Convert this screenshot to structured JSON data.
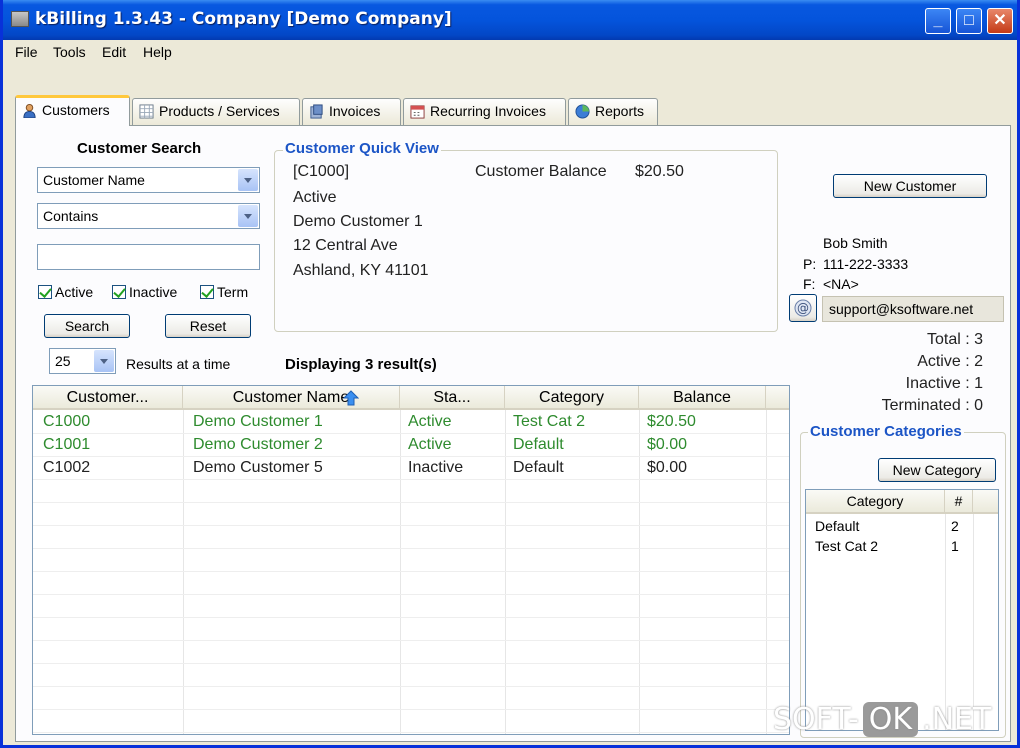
{
  "window": {
    "title": "kBilling 1.3.43 - Company [Demo Company]"
  },
  "menu": [
    "File",
    "Tools",
    "Edit",
    "Help"
  ],
  "tabs": [
    {
      "label": "Customers",
      "active": true,
      "icon": "person-icon"
    },
    {
      "label": "Products / Services",
      "icon": "table-icon"
    },
    {
      "label": "Invoices",
      "icon": "invoice-icon"
    },
    {
      "label": "Recurring Invoices",
      "icon": "calendar-icon"
    },
    {
      "label": "Reports",
      "icon": "chart-icon"
    }
  ],
  "search": {
    "title": "Customer Search",
    "field_select": "Customer Name",
    "operator_select": "Contains",
    "query": "",
    "checkboxes": [
      {
        "label": "Active",
        "checked": true
      },
      {
        "label": "Inactive",
        "checked": true
      },
      {
        "label": "Term",
        "checked": true
      }
    ],
    "search_button": "Search",
    "reset_button": "Reset",
    "results_per_page": "25",
    "results_label": "Results at a time"
  },
  "quick_view": {
    "title": "Customer Quick View",
    "id": "[C1000]",
    "status": "Active",
    "name": "Demo Customer 1",
    "address1": "12 Central Ave",
    "address2": "Ashland, KY 41101",
    "balance_label": "Customer Balance",
    "balance_value": "$20.50"
  },
  "results": {
    "display_text": "Displaying 3 result(s)",
    "columns": [
      "Customer...",
      "Customer Name",
      "Sta...",
      "Category",
      "Balance"
    ],
    "rows": [
      {
        "id": "C1000",
        "name": "Demo Customer 1",
        "status": "Active",
        "category": "Test Cat 2",
        "balance": "$20.50",
        "color": "#2e8b2e"
      },
      {
        "id": "C1001",
        "name": "Demo Customer 2",
        "status": "Active",
        "category": "Default",
        "balance": "$0.00",
        "color": "#2e8b2e"
      },
      {
        "id": "C1002",
        "name": "Demo Customer 5",
        "status": "Inactive",
        "category": "Default",
        "balance": "$0.00",
        "color": "#222222"
      }
    ]
  },
  "contact": {
    "new_customer_button": "New Customer",
    "name": "Bob Smith",
    "phone_label": "P:",
    "phone": "111-222-3333",
    "fax_label": "F:",
    "fax": "<NA>",
    "email": "support@ksoftware.net"
  },
  "counts": {
    "total": "Total : 3",
    "active": "Active : 2",
    "inactive": "Inactive : 1",
    "terminated": "Terminated : 0"
  },
  "categories": {
    "title": "Customer Categories",
    "new_button": "New Category",
    "columns": [
      "Category",
      "#"
    ],
    "rows": [
      {
        "name": "Default",
        "count": "2"
      },
      {
        "name": "Test Cat 2",
        "count": "1"
      }
    ]
  },
  "watermark": {
    "left": "SOFT-",
    "middle": "OK",
    "right": ".NET"
  },
  "colors": {
    "accent": "#1c55c6",
    "active_row": "#2e8b2e",
    "titlebar": "#0454dc"
  }
}
